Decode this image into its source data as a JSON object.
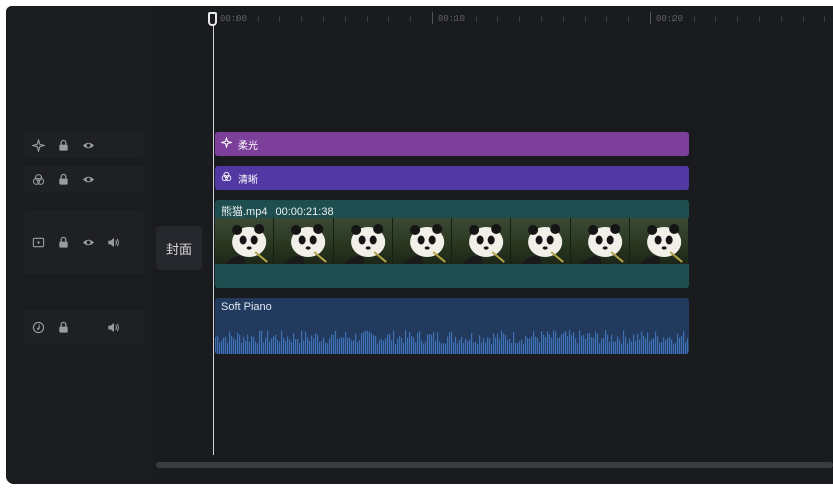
{
  "ruler": {
    "marks": [
      "00:00",
      "00:10",
      "00:20"
    ]
  },
  "tracks": {
    "soft_light": {
      "label": "柔光",
      "color": "#7c3f9a"
    },
    "clear": {
      "label": "清晰",
      "color": "#5138a3"
    },
    "video": {
      "filename": "熊猫.mp4",
      "duration": "00:00:21:38",
      "color": "#1f4e50"
    },
    "audio": {
      "title": "Soft Piano",
      "color": "#213a5d"
    }
  },
  "cover_button": "封面",
  "icons": {
    "effect": "sparkle-icon",
    "filter": "filter-circles-icon",
    "video": "video-frame-icon",
    "audio": "music-note-icon",
    "lock": "lock-icon",
    "visibility": "eye-icon",
    "volume": "speaker-icon"
  }
}
